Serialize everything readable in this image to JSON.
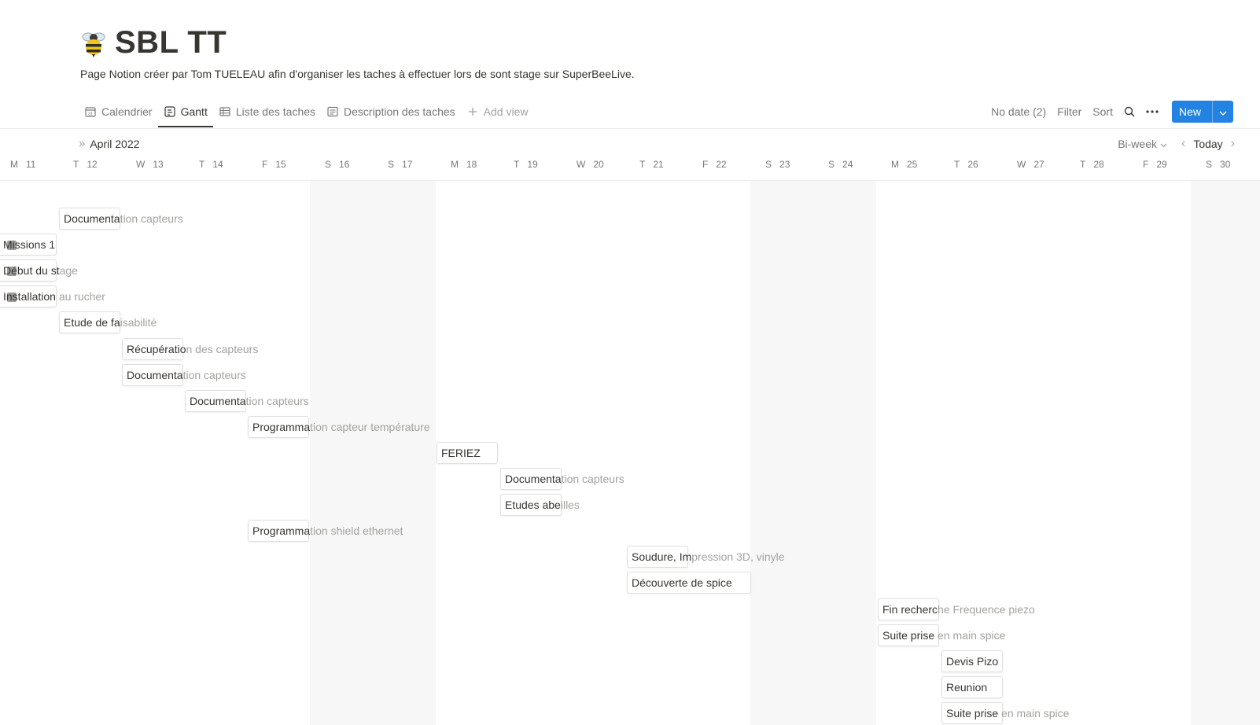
{
  "page": {
    "icon": "bee-icon",
    "title": "SBL TT",
    "description": "Page Notion créer par Tom TUELEAU afin d'organiser les taches à effectuer lors de sont stage sur SuperBeeLive."
  },
  "views": [
    {
      "label": "Calendrier",
      "icon": "calendar-icon",
      "active": false
    },
    {
      "label": "Gantt",
      "icon": "timeline-icon",
      "active": true
    },
    {
      "label": "Liste des taches",
      "icon": "table-icon",
      "active": false
    },
    {
      "label": "Description des taches",
      "icon": "board-icon",
      "active": false
    }
  ],
  "add_view_label": "Add view",
  "toolbar": {
    "no_date": "No date (2)",
    "filter": "Filter",
    "sort": "Sort",
    "new_label": "New",
    "accent": "#2383e2"
  },
  "gantt": {
    "month": "April 2022",
    "range_mode": "Bi-week",
    "today_label": "Today",
    "days": [
      {
        "dow": "M",
        "num": "11"
      },
      {
        "dow": "T",
        "num": "12"
      },
      {
        "dow": "W",
        "num": "13"
      },
      {
        "dow": "T",
        "num": "14"
      },
      {
        "dow": "F",
        "num": "15"
      },
      {
        "dow": "S",
        "num": "16"
      },
      {
        "dow": "S",
        "num": "17"
      },
      {
        "dow": "M",
        "num": "18"
      },
      {
        "dow": "T",
        "num": "19"
      },
      {
        "dow": "W",
        "num": "20"
      },
      {
        "dow": "T",
        "num": "21"
      },
      {
        "dow": "F",
        "num": "22"
      },
      {
        "dow": "S",
        "num": "23"
      },
      {
        "dow": "S",
        "num": "24"
      },
      {
        "dow": "M",
        "num": "25"
      },
      {
        "dow": "T",
        "num": "26"
      },
      {
        "dow": "W",
        "num": "27"
      },
      {
        "dow": "T",
        "num": "28"
      },
      {
        "dow": "F",
        "num": "29"
      },
      {
        "dow": "S",
        "num": "30"
      }
    ],
    "tasks": [
      {
        "inside": "Documenta",
        "outside": "tion capteurs"
      },
      {
        "inside": "Missions 1",
        "outside": ""
      },
      {
        "inside": "Début du st",
        "outside": "age"
      },
      {
        "inside": "Installation",
        "outside": " au rucher"
      },
      {
        "inside": "Etude de fa",
        "outside": "isabilité"
      },
      {
        "inside": "Récupératio",
        "outside": "n des capteurs"
      },
      {
        "inside": "Documenta",
        "outside": "tion capteurs"
      },
      {
        "inside": "Documenta",
        "outside": "tion capteurs"
      },
      {
        "inside": "Programma",
        "outside": "tion capteur température"
      },
      {
        "inside": "FERIEZ",
        "outside": ""
      },
      {
        "inside": "Documenta",
        "outside": "tion capteurs"
      },
      {
        "inside": "Etudes abe",
        "outside": "illes"
      },
      {
        "inside": "Programma",
        "outside": "tion shield ethernet"
      },
      {
        "inside": "Soudure, Im",
        "outside": "pression 3D, vinyle"
      },
      {
        "inside": "Découverte de spice",
        "outside": ""
      },
      {
        "inside": "Fin recherc",
        "outside": "he Frequence piezo"
      },
      {
        "inside": "Suite prise",
        "outside": " en main spice"
      },
      {
        "inside": "Devis Pizo",
        "outside": ""
      },
      {
        "inside": "Reunion",
        "outside": ""
      },
      {
        "inside": "Suite prise",
        "outside": " en main spice"
      }
    ]
  }
}
